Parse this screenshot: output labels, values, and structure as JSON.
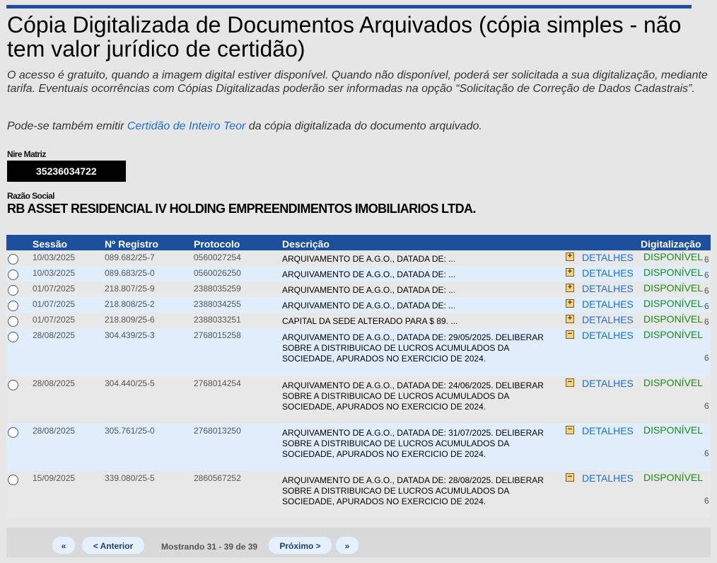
{
  "header": {
    "title": "Cópia Digitalizada de Documentos Arquivados (cópia simples - não tem valor jurídico de certidão)",
    "intro": "O acesso é gratuito, quando a imagem digital estiver disponível. Quando não disponível, poderá ser solicitada a sua digitalização, mediante tarifa. Eventuais ocorrências com Cópias Digitalizadas poderão ser informadas na opção “Solicitação de Correção de Dados Cadastrais”.",
    "intro2_before": "Pode-se também emitir ",
    "intro2_link": "Certidão de Inteiro Teor",
    "intro2_after": " da cópia digitalizada do documento arquivado."
  },
  "company": {
    "nire_label": "Nire Matriz",
    "nire_value": "35236034722",
    "razao_label": "Razão Social",
    "razao_value": "RB ASSET RESIDENCIAL IV HOLDING EMPREENDIMENTOS IMOBILIARIOS LTDA."
  },
  "table": {
    "headers": {
      "sessao": "Sessão",
      "registro": "Nº Registro",
      "protocolo": "Protocolo",
      "descricao": "Descrição",
      "digitalizacao": "Digitalização"
    },
    "rows": [
      {
        "sessao": "10/03/2025",
        "registro": "089.682/25-7",
        "protocolo": "0560027254",
        "descricao": "ARQUIVAMENTO DE A.G.O., DATADA DE: ...",
        "toggle": "+",
        "detalhes": "DETALHES",
        "status": "DISPONÍVEL",
        "extra": "6"
      },
      {
        "sessao": "10/03/2025",
        "registro": "089.683/25-0",
        "protocolo": "0560026250",
        "descricao": "ARQUIVAMENTO DE A.G.O., DATADA DE: ...",
        "toggle": "+",
        "detalhes": "DETALHES",
        "status": "DISPONÍVEL",
        "extra": "6"
      },
      {
        "sessao": "01/07/2025",
        "registro": "218.807/25-9",
        "protocolo": "2388035259",
        "descricao": "ARQUIVAMENTO DE A.G.O., DATADA DE: ...",
        "toggle": "+",
        "detalhes": "DETALHES",
        "status": "DISPONÍVEL",
        "extra": "6"
      },
      {
        "sessao": "01/07/2025",
        "registro": "218.808/25-2",
        "protocolo": "2388034255",
        "descricao": "ARQUIVAMENTO DE A.G.O., DATADA DE: ...",
        "toggle": "+",
        "detalhes": "DETALHES",
        "status": "DISPONÍVEL",
        "extra": "6"
      },
      {
        "sessao": "01/07/2025",
        "registro": "218.809/25-6",
        "protocolo": "2388033251",
        "descricao": "CAPITAL DA SEDE ALTERADO PARA $ 89. ...",
        "toggle": "+",
        "detalhes": "DETALHES",
        "status": "DISPONÍVEL",
        "extra": "6"
      },
      {
        "sessao": "28/08/2025",
        "registro": "304.439/25-3",
        "protocolo": "2768015258",
        "descricao": "ARQUIVAMENTO DE A.G.O., DATADA DE: 29/05/2025. DELIBERAR SOBRE A DISTRIBUICAO DE LUCROS ACUMULADOS DA SOCIEDADE, APURADOS NO EXERCICIO DE 2024.",
        "toggle": "−",
        "detalhes": "DETALHES",
        "status": "DISPONÍVEL",
        "extra": "6"
      },
      {
        "sessao": "28/08/2025",
        "registro": "304.440/25-5",
        "protocolo": "2768014254",
        "descricao": "ARQUIVAMENTO DE A.G.O., DATADA DE: 24/06/2025. DELIBERAR SOBRE A DISTRIBUICAO DE LUCROS ACUMULADOS DA SOCIEDADE, APURADOS NO EXERCICIO DE 2024.",
        "toggle": "−",
        "detalhes": "DETALHES",
        "status": "DISPONÍVEL",
        "extra": "6"
      },
      {
        "sessao": "28/08/2025",
        "registro": "305.761/25-0",
        "protocolo": "2768013250",
        "descricao": "ARQUIVAMENTO DE A.G.O., DATADA DE: 31/07/2025. DELIBERAR SOBRE A DISTRIBUICAO DE LUCROS ACUMULADOS DA SOCIEDADE, APURADOS NO EXERCICIO DE 2024.",
        "toggle": "−",
        "detalhes": "DETALHES",
        "status": "DISPONÍVEL",
        "extra": "6"
      },
      {
        "sessao": "15/09/2025",
        "registro": "339.080/25-5",
        "protocolo": "2860567252",
        "descricao": "ARQUIVAMENTO DE A.G.O., DATADA DE: 28/08/2025. DELIBERAR SOBRE A DISTRIBUICAO DE LUCROS ACUMULADOS DA SOCIEDADE, APURADOS NO EXERCICIO DE 2024.",
        "toggle": "−",
        "detalhes": "DETALHES",
        "status": "DISPONÍVEL",
        "extra": "6"
      }
    ]
  },
  "pager": {
    "first": "«",
    "prev": "< Anterior",
    "info": "Mostrando 31 - 39 de 39",
    "next": "Próximo >",
    "last": "»"
  }
}
